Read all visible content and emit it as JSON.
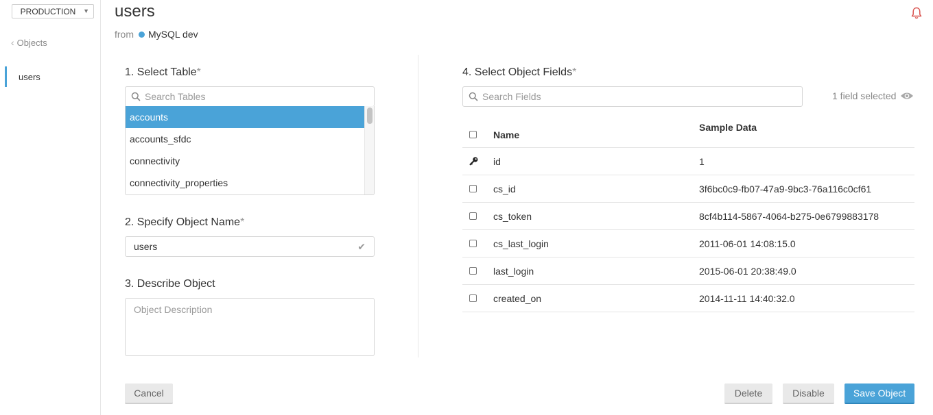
{
  "sidebar": {
    "environment": "PRODUCTION",
    "back_label": "Objects",
    "items": [
      {
        "label": "users"
      }
    ]
  },
  "header": {
    "title": "users",
    "from_label": "from",
    "source_name": "MySQL dev"
  },
  "step1": {
    "label": "1. Select Table",
    "required": "*",
    "search_placeholder": "Search Tables",
    "tables": [
      "accounts",
      "accounts_sfdc",
      "connectivity",
      "connectivity_properties"
    ],
    "selected": "accounts"
  },
  "step2": {
    "label": "2. Specify Object Name",
    "required": "*",
    "value": "users"
  },
  "step3": {
    "label": "3. Describe Object",
    "placeholder": "Object Description"
  },
  "step4": {
    "label": "4. Select Object Fields",
    "required": "*",
    "search_placeholder": "Search Fields",
    "selected_count_label": "1 field selected",
    "columns": {
      "name": "Name",
      "sample": "Sample Data"
    },
    "rows": [
      {
        "name": "id",
        "sample": "1",
        "is_key": true
      },
      {
        "name": "cs_id",
        "sample": "3f6bc0c9-fb07-47a9-9bc3-76a116c0cf61",
        "is_key": false
      },
      {
        "name": "cs_token",
        "sample": "8cf4b114-5867-4064-b275-0e6799883178",
        "is_key": false
      },
      {
        "name": "cs_last_login",
        "sample": "2011-06-01 14:08:15.0",
        "is_key": false
      },
      {
        "name": "last_login",
        "sample": "2015-06-01 20:38:49.0",
        "is_key": false
      },
      {
        "name": "created_on",
        "sample": "2014-11-11 14:40:32.0",
        "is_key": false
      }
    ]
  },
  "footer": {
    "cancel": "Cancel",
    "delete": "Delete",
    "disable": "Disable",
    "save": "Save Object"
  },
  "colors": {
    "accent": "#4aa3d8",
    "notification": "#d9534f"
  }
}
